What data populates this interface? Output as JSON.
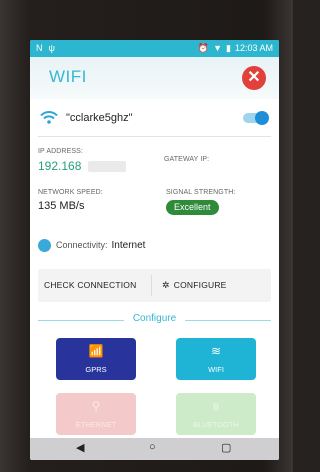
{
  "status_bar": {
    "left_icons": [
      "N",
      "ψ"
    ],
    "right_icons": [
      "alarm-icon",
      "wifi-signal-icon",
      "battery-icon"
    ],
    "time": "12:03 AM"
  },
  "header": {
    "title": "WIFI",
    "close_symbol": "✕"
  },
  "network": {
    "ssid": "\"cclarke5ghz\"",
    "enabled": true
  },
  "info": {
    "ip_label": "IP ADDRESS:",
    "ip_value": "192.168",
    "gateway_label": "GATEWAY IP:",
    "speed_label": "NETWORK SPEED:",
    "speed_value": "135 MB/s",
    "signal_label": "SIGNAL STRENGTH:",
    "signal_value": "Excellent"
  },
  "connectivity": {
    "label": "Connectivity:",
    "value": "Internet"
  },
  "actions": {
    "check_label": "CHECK CONNECTION",
    "configure_label": "CONFIGURE",
    "gear_symbol": "✲"
  },
  "configure_section": {
    "title": "Configure",
    "tiles": [
      {
        "label": "GPRS",
        "symbol": "📶"
      },
      {
        "label": "WIFI",
        "symbol": "≋"
      },
      {
        "label": "ETHERNET",
        "symbol": "⚲"
      },
      {
        "label": "BLUETOOTH",
        "symbol": "ʙ"
      }
    ]
  },
  "nav": {
    "back": "◀",
    "home": "○",
    "recents": "▢"
  },
  "colors": {
    "accent": "#38b7d3",
    "close": "#e2403a",
    "gprs": "#28349b",
    "wifi": "#1fb3d6",
    "ethernet": "#f4c9c9",
    "bluetooth": "#cdebc9",
    "badge": "#2f8a3a"
  }
}
